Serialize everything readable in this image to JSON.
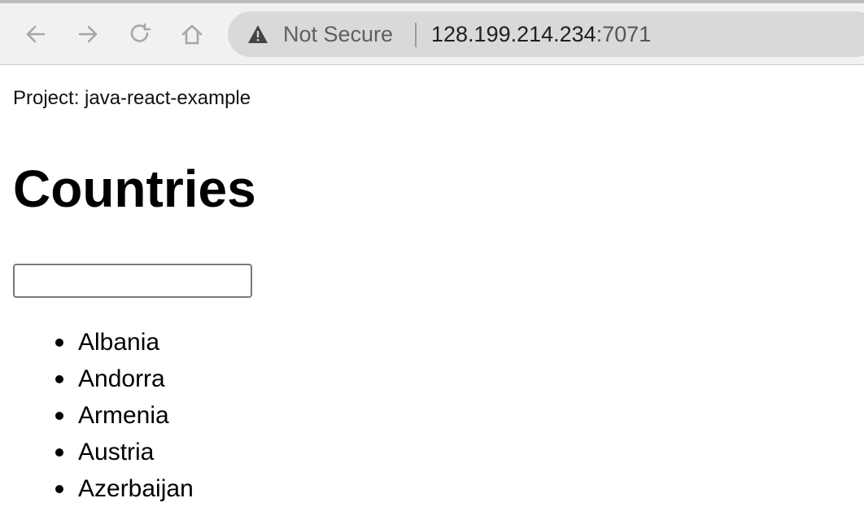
{
  "browser": {
    "security_label": "Not Secure",
    "url_host": "128.199.214.234",
    "url_port": ":7071",
    "icons": {
      "back": "back-arrow-icon",
      "forward": "forward-arrow-icon",
      "reload": "reload-icon",
      "home": "home-icon",
      "security": "warning-triangle-icon"
    },
    "colors": {
      "toolbar": "#f1f1f1",
      "omnibox": "#d9d9d9",
      "icon_gray": "#9a9a9a"
    }
  },
  "page": {
    "project_line": "Project: java-react-example",
    "title": "Countries",
    "filter_value": "",
    "countries": [
      "Albania",
      "Andorra",
      "Armenia",
      "Austria",
      "Azerbaijan"
    ]
  }
}
